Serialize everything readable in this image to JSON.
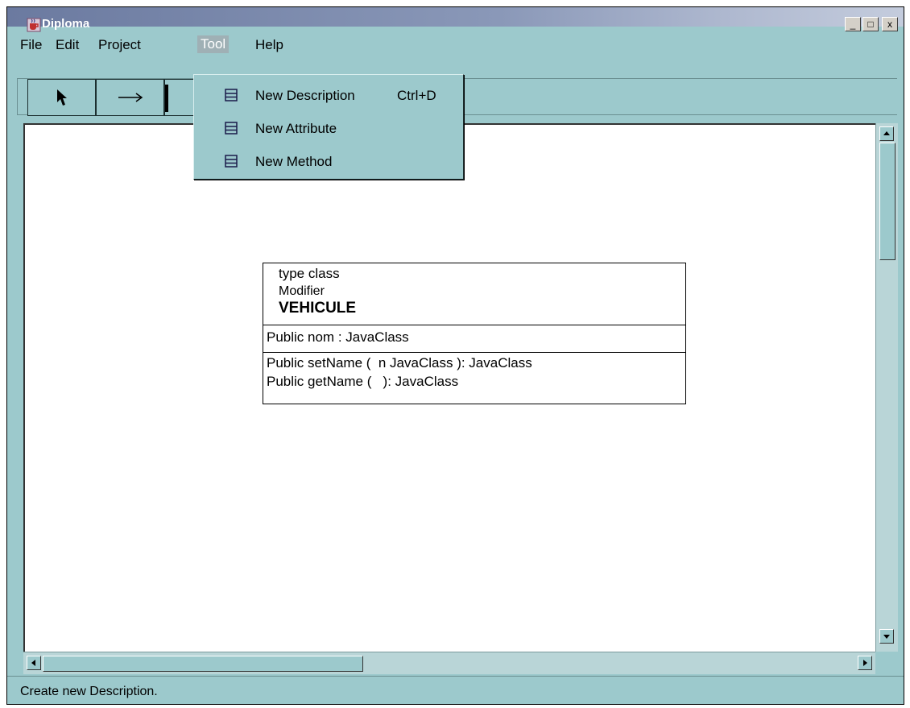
{
  "window": {
    "title": "Diploma",
    "minimize_label": "_",
    "maximize_label": "□",
    "close_label": "x"
  },
  "menubar": {
    "items": [
      "File",
      "Edit",
      "Project",
      "Tool",
      "Help"
    ],
    "active": "Tool"
  },
  "toolbar": {
    "tools": [
      {
        "name": "select",
        "icon": "arrow-pointer-icon"
      },
      {
        "name": "association",
        "icon": "right-arrow-icon"
      },
      {
        "name": "class",
        "icon": "class-tool-icon"
      }
    ]
  },
  "tool_menu": {
    "items": [
      {
        "label": "New Description",
        "accelerator": "Ctrl+D",
        "icon": "list-icon"
      },
      {
        "label": "New Attribute",
        "accelerator": "",
        "icon": "list-icon"
      },
      {
        "label": "New Method",
        "accelerator": "",
        "icon": "list-icon"
      }
    ]
  },
  "uml_class": {
    "type_line": "type class",
    "modifier_line": "Modifier",
    "name": "VEHICULE",
    "attributes": [
      "Public nom : JavaClass"
    ],
    "methods": [
      "Public setName (  n JavaClass ): JavaClass",
      "Public getName (   ): JavaClass"
    ]
  },
  "status": {
    "text": "Create new Description."
  },
  "colors": {
    "window_background": "#9cc9cc",
    "title_gradient_start": "#6b7aa0",
    "canvas": "#ffffff",
    "menu_highlight": "#9fb0b5"
  }
}
